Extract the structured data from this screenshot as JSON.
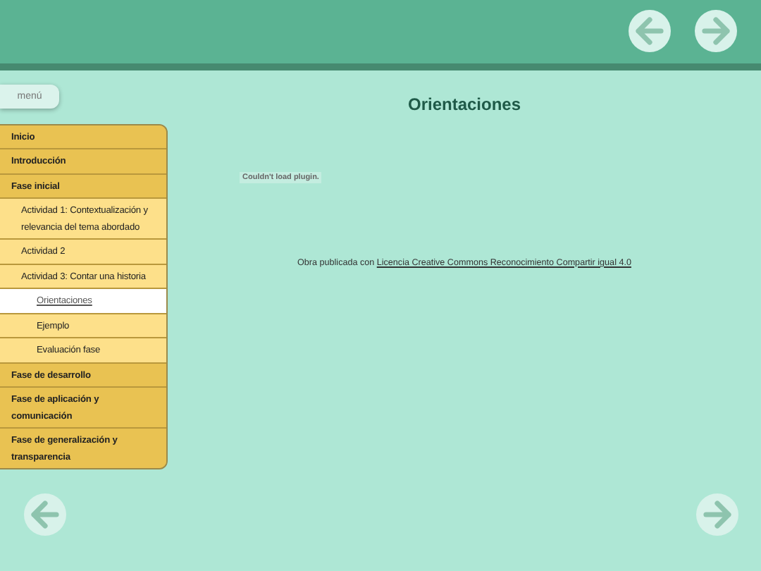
{
  "menu_button": {
    "label": "menú"
  },
  "menu": [
    {
      "label": "Inicio",
      "selected": false
    },
    {
      "label": "Introducción",
      "selected": false
    },
    {
      "label": "Fase inicial",
      "selected": false,
      "children": [
        {
          "label": "Actividad 1: Contextualización y relevancia del tema abordado",
          "selected": false
        },
        {
          "label": "Actividad 2",
          "selected": false
        },
        {
          "label": "Actividad 3: Contar una historia",
          "selected": false,
          "children": [
            {
              "label": "Orientaciones",
              "selected": true
            },
            {
              "label": "Ejemplo",
              "selected": false
            },
            {
              "label": "Evaluación fase",
              "selected": false
            }
          ]
        }
      ]
    },
    {
      "label": "Fase de desarrollo",
      "selected": false
    },
    {
      "label": "Fase de aplicación y comunicación",
      "selected": false
    },
    {
      "label": "Fase de generalización y transparencia",
      "selected": false
    }
  ],
  "page_title": "Orientaciones",
  "plugin_message": "Couldn't load plugin.",
  "footer": {
    "text": "Obra publicada con",
    "link": "Licencia Creative Commons Reconocimiento Compartir igual 4.0"
  }
}
